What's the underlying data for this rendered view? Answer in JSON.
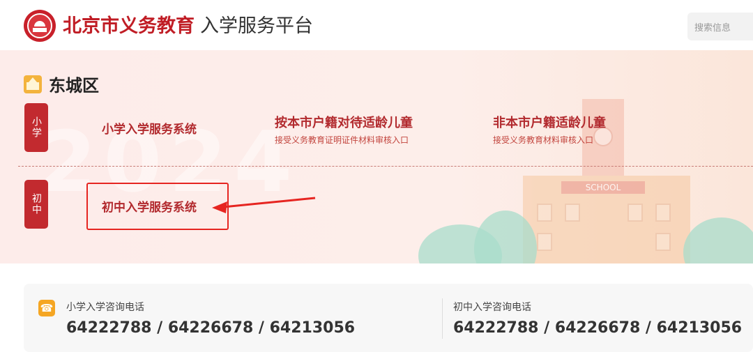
{
  "header": {
    "title_strong": "北京市义务教育",
    "title_light": "入学服务平台",
    "search_placeholder": "搜索信息"
  },
  "banner": {
    "district": "东城区",
    "primary": {
      "tag": "小学",
      "system_link": "小学入学服务系统",
      "options": [
        {
          "title": "按本市户籍对待适龄儿童",
          "subtitle": "接受义务教育证明证件材料审核入口"
        },
        {
          "title": "非本市户籍适龄儿童",
          "subtitle": "接受义务教育材料审核入口"
        }
      ]
    },
    "middle": {
      "tag": "初中",
      "system_link": "初中入学服务系统"
    },
    "school_sign": "SCHOOL"
  },
  "contact": {
    "primary_label": "小学入学咨询电话",
    "primary_numbers": "64222788 / 64226678 / 64213056",
    "middle_label": "初中入学咨询电话",
    "middle_numbers": "64222788 / 64226678 / 64213056"
  },
  "colors": {
    "brand_red": "#c01d25",
    "annotation_red": "#e62521",
    "phone_icon": "#f5a623"
  }
}
